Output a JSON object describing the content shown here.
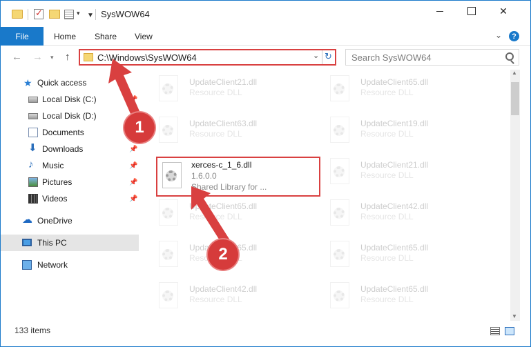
{
  "window": {
    "title": "SysWOW64"
  },
  "ribbon": {
    "file": "File",
    "home": "Home",
    "share": "Share",
    "view": "View"
  },
  "address": {
    "path": "C:\\Windows\\SysWOW64"
  },
  "search": {
    "placeholder": "Search SysWOW64"
  },
  "sidebar": {
    "items": [
      {
        "label": "Quick access"
      },
      {
        "label": "Local Disk (C:)"
      },
      {
        "label": "Local Disk (D:)"
      },
      {
        "label": "Documents"
      },
      {
        "label": "Downloads"
      },
      {
        "label": "Music"
      },
      {
        "label": "Pictures"
      },
      {
        "label": "Videos"
      },
      {
        "label": "OneDrive"
      },
      {
        "label": "This PC"
      },
      {
        "label": "Network"
      }
    ]
  },
  "files": {
    "col1": [
      {
        "name": "UpdateClient21.dll",
        "type": "Resource DLL"
      },
      {
        "name": "UpdateClient63.dll",
        "type": "Resource DLL"
      },
      {
        "name": "xerces-c_1_6.dll",
        "version": "1.6.0.0",
        "type": "Shared Library for ..."
      },
      {
        "name": "UpdateClient65.dll",
        "type": "Resource DLL"
      },
      {
        "name": "UpdateClient65.dll",
        "type": "Resource DLL"
      },
      {
        "name": "UpdateClient42.dll",
        "type": "Resource DLL"
      }
    ],
    "col2": [
      {
        "name": "UpdateClient65.dll",
        "type": "Resource DLL"
      },
      {
        "name": "UpdateClient19.dll",
        "type": "Resource DLL"
      },
      {
        "name": "UpdateClient21.dll",
        "type": "Resource DLL"
      },
      {
        "name": "UpdateClient42.dll",
        "type": "Resource DLL"
      },
      {
        "name": "UpdateClient65.dll",
        "type": "Resource DLL"
      },
      {
        "name": "UpdateClient65.dll",
        "type": "Resource DLL"
      }
    ]
  },
  "status": {
    "count": "133 items"
  },
  "annotations": {
    "badge1": "1",
    "badge2": "2",
    "color": "#d94040"
  }
}
